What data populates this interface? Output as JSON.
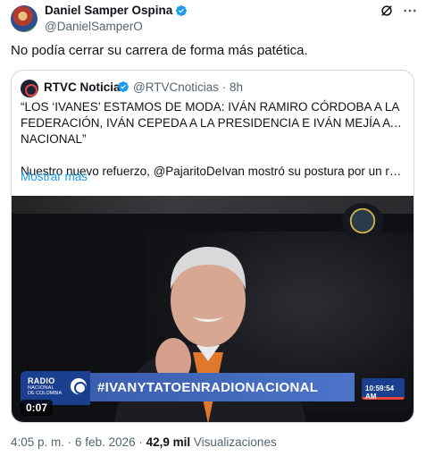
{
  "post": {
    "author_name": "Daniel Samper Ospina",
    "author_handle": "@DanielSamperO",
    "text": "No podía cerrar su carrera de forma más patética."
  },
  "quoted": {
    "author_name": "RTVC Noticias",
    "author_handle": "@RTVCnoticias",
    "age": "· 8h",
    "lines": [
      "“LOS ‘IVANES’ ESTAMOS DE MODA: IVÁN RAMIRO CÓRDOBA A LA",
      "FEDERACIÓN, IVÁN CEPEDA A LA PRESIDENCIA E IVÁN MEJÍA A RADIO",
      "NACIONAL”"
    ],
    "line2": "Nuestro nuevo refuerzo, @PajaritoDeIvan mostró su postura por un rumbo ...",
    "show_more": "Mostrar más",
    "video": {
      "station_line1": "RADIO",
      "station_line2": "NACIONAL",
      "station_line3": "DE COLOMBIA",
      "hashtag": "#IVANYTATOENRADIONACIONAL",
      "clock": "10:59:54 AM",
      "duration": "0:07"
    }
  },
  "meta": {
    "time": "4:05 p. m.",
    "sep1": " · ",
    "date": "6 feb. 2026",
    "sep2": " · ",
    "views": "42,9 mil",
    "views_label": " Visualizaciones"
  },
  "colors": {
    "accent": "#1d9bf0",
    "muted": "#536471",
    "border": "#cfd9de",
    "station_blue": "#1b3f8f"
  },
  "icons": [
    "verified-badge-icon",
    "grok-icon",
    "more-icon",
    "rtvc-logo-icon",
    "radio-nacional-logo-icon"
  ]
}
